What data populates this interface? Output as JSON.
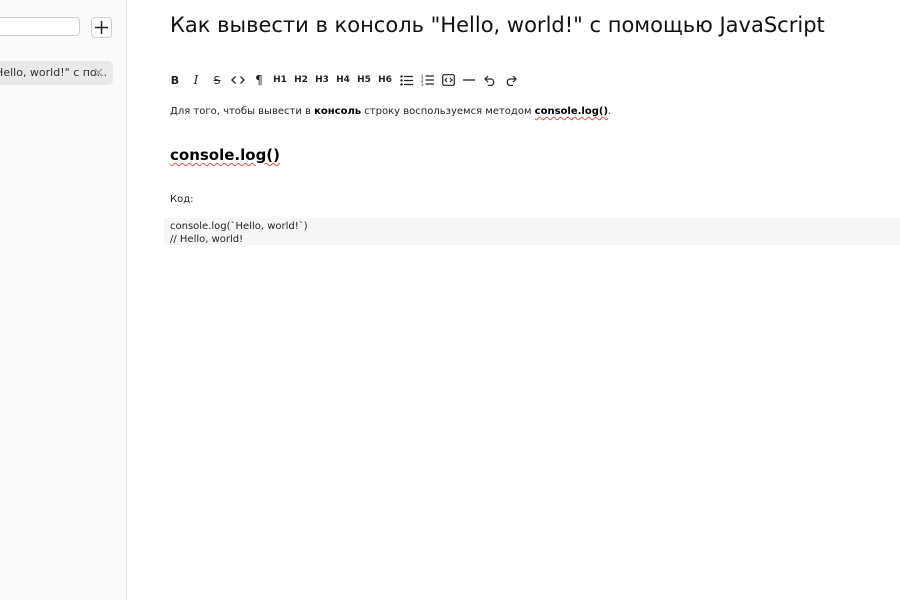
{
  "sidebar": {
    "search_value": "",
    "add_button_label": "+",
    "note_item_label": "\"Hello, world!\" с по...",
    "close_label": "×"
  },
  "document": {
    "title": "Как вывести в консоль \"Hello, world!\" с помощью JavaScript",
    "paragraph": {
      "text1": "Для того, чтобы вывести в ",
      "bold1": "консоль",
      "text2": " строку воспользуемся методом ",
      "bold2": "console.log()",
      "text3": "."
    },
    "heading": "console.log()",
    "code_label": "Код:",
    "code_line1": "console.log(`Hello, world!`)",
    "code_line2": "// Hello, world!"
  },
  "toolbar": {
    "bold": "B",
    "italic": "I",
    "strike": "S",
    "code": "<>",
    "paragraph": "¶",
    "h1": "H1",
    "h2": "H2",
    "h3": "H3",
    "h4": "H4",
    "h5": "H5",
    "h6": "H6",
    "icons": [
      "bold-icon",
      "italic-icon",
      "strikethrough-icon",
      "code-icon",
      "paragraph-icon",
      "bullet-list-icon",
      "ordered-list-icon",
      "code-block-icon",
      "horizontal-rule-icon",
      "undo-icon",
      "redo-icon"
    ]
  },
  "colors": {
    "sidebar_bg": "#fafafa",
    "selected_item_bg": "#e9e9e9",
    "code_bg": "#f6f6f6",
    "spellcheck": "#e05050"
  }
}
